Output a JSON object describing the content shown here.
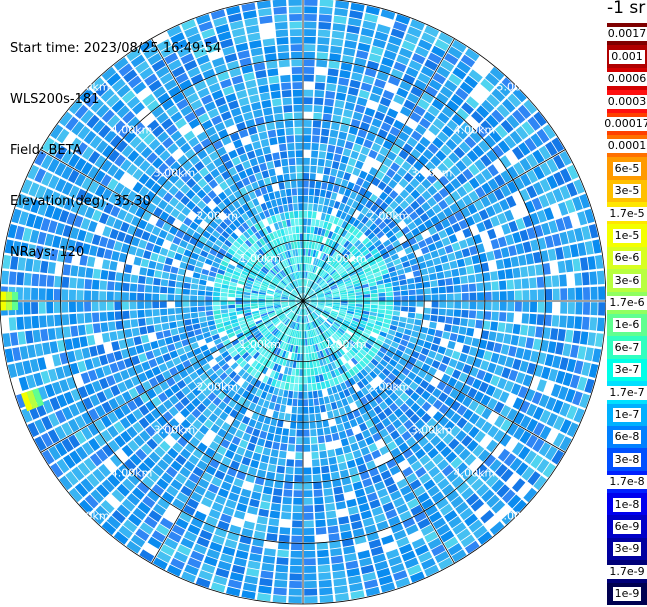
{
  "header": {
    "start_time": "Start time: 2023/08/25 16:49:54",
    "instrument": "WLS200s-181",
    "field": "Field: BETA",
    "elevation": "Elevation(deg): 35.30",
    "nrays": "NRays: 120"
  },
  "colorbar": {
    "unit_label": "-1 sr",
    "labels": [
      "0.0017",
      "0.001",
      "0.0006",
      "0.0003",
      "0.00017",
      "0.0001",
      "6e-5",
      "3e-5",
      "1.7e-5",
      "1e-5",
      "6e-6",
      "3e-6",
      "1.7e-6",
      "1e-6",
      "6e-7",
      "3e-7",
      "1.7e-7",
      "1e-7",
      "6e-8",
      "3e-8",
      "1.7e-8",
      "1e-8",
      "6e-9",
      "3e-9",
      "1.7e-9",
      "1e-9"
    ],
    "colors": [
      "#7f0000",
      "#b00000",
      "#d40000",
      "#ff1010",
      "#ff4000",
      "#ff7000",
      "#ff9a00",
      "#ffc000",
      "#ffe600",
      "#f4ff00",
      "#d8ff20",
      "#b8ff40",
      "#90ff60",
      "#60ff90",
      "#30ffc0",
      "#00ffe8",
      "#00e0ff",
      "#00b0ff",
      "#0080ff",
      "#0050ff",
      "#0020ff",
      "#0000ee",
      "#0000c8",
      "#0000a0",
      "#000078",
      "#000050"
    ]
  },
  "chart_data": {
    "type": "heatmap",
    "projection": "polar (PPI scan)",
    "field": "BETA",
    "n_rays": 120,
    "max_range_km": 5.0,
    "range_rings_km": [
      1.0,
      2.0,
      3.0,
      4.0,
      5.0
    ],
    "ring_labels": [
      "1.00km",
      "2.00km",
      "3.00km",
      "4.00km",
      "5.00km"
    ],
    "radial_spokes_deg": [
      0,
      30,
      60,
      90,
      120,
      150,
      180,
      210,
      240,
      270,
      300,
      330
    ],
    "value_scale": "log",
    "value_range": [
      1e-09,
      0.0017
    ],
    "typical_value_near_km": {
      "0-1.5": "3e-7",
      "1.5-5": "3e-8 to 1e-7"
    },
    "hotspots": [
      {
        "azimuth_deg": 270,
        "range_km": 5.0,
        "value": "1e-5"
      },
      {
        "azimuth_deg": 250,
        "range_km": 4.9,
        "value": "1.7e-5"
      }
    ]
  }
}
